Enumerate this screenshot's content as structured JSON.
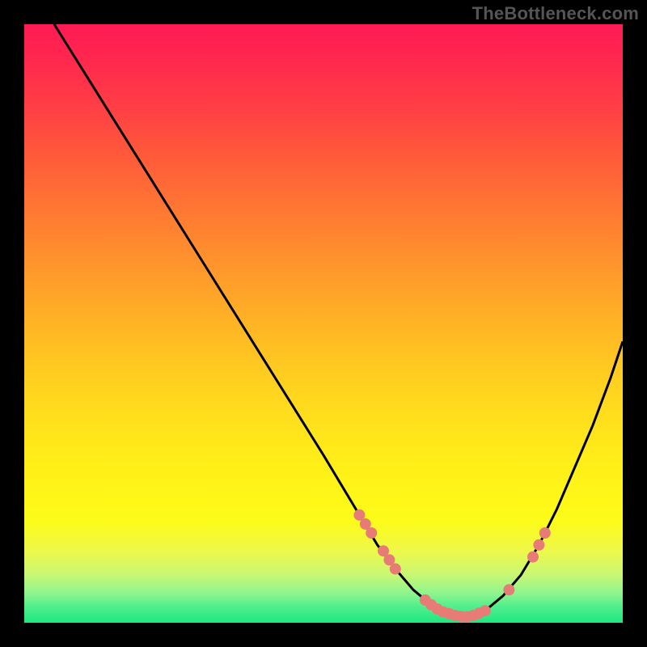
{
  "watermark": "TheBottleneck.com",
  "colors": {
    "background": "#000000",
    "gradient_top": "#ff1a55",
    "gradient_bottom": "#1de77f",
    "curve": "#000000",
    "dot": "#e77c76"
  },
  "chart_data": {
    "type": "line",
    "title": "",
    "xlabel": "",
    "ylabel": "",
    "xlim": [
      0,
      100
    ],
    "ylim": [
      0,
      100
    ],
    "grid": false,
    "legend": false,
    "series": [
      {
        "name": "curve",
        "x": [
          5,
          10,
          15,
          20,
          25,
          30,
          35,
          40,
          45,
          50,
          53,
          56,
          59,
          62,
          65,
          68,
          71,
          74,
          77,
          80,
          83,
          86,
          89,
          92,
          95,
          98,
          100
        ],
        "y": [
          100,
          92,
          84,
          76,
          68,
          60,
          52,
          44,
          36,
          28,
          23,
          18,
          13,
          9,
          5.5,
          3,
          1.5,
          1,
          2,
          4.5,
          8,
          13,
          19,
          26,
          33,
          41,
          47
        ]
      }
    ],
    "points_on_curve": [
      {
        "name": "p1",
        "x": 56,
        "y": 18
      },
      {
        "name": "p2",
        "x": 57,
        "y": 16.5
      },
      {
        "name": "p3",
        "x": 58,
        "y": 15
      },
      {
        "name": "p4",
        "x": 60,
        "y": 12
      },
      {
        "name": "p5",
        "x": 61,
        "y": 10.5
      },
      {
        "name": "p6",
        "x": 62,
        "y": 9
      },
      {
        "name": "p7",
        "x": 67,
        "y": 3.8
      },
      {
        "name": "p8",
        "x": 68,
        "y": 3
      },
      {
        "name": "p9",
        "x": 69,
        "y": 2.3
      },
      {
        "name": "p10",
        "x": 70,
        "y": 1.8
      },
      {
        "name": "p11",
        "x": 71,
        "y": 1.5
      },
      {
        "name": "p12",
        "x": 72,
        "y": 1.2
      },
      {
        "name": "p13",
        "x": 73,
        "y": 1.05
      },
      {
        "name": "p14",
        "x": 74,
        "y": 1
      },
      {
        "name": "p15",
        "x": 75,
        "y": 1.2
      },
      {
        "name": "p16",
        "x": 76,
        "y": 1.6
      },
      {
        "name": "p17",
        "x": 77,
        "y": 2
      },
      {
        "name": "p18",
        "x": 81,
        "y": 5.5
      },
      {
        "name": "p19",
        "x": 85,
        "y": 11
      },
      {
        "name": "p20",
        "x": 86,
        "y": 13
      },
      {
        "name": "p21",
        "x": 87,
        "y": 15
      }
    ]
  }
}
